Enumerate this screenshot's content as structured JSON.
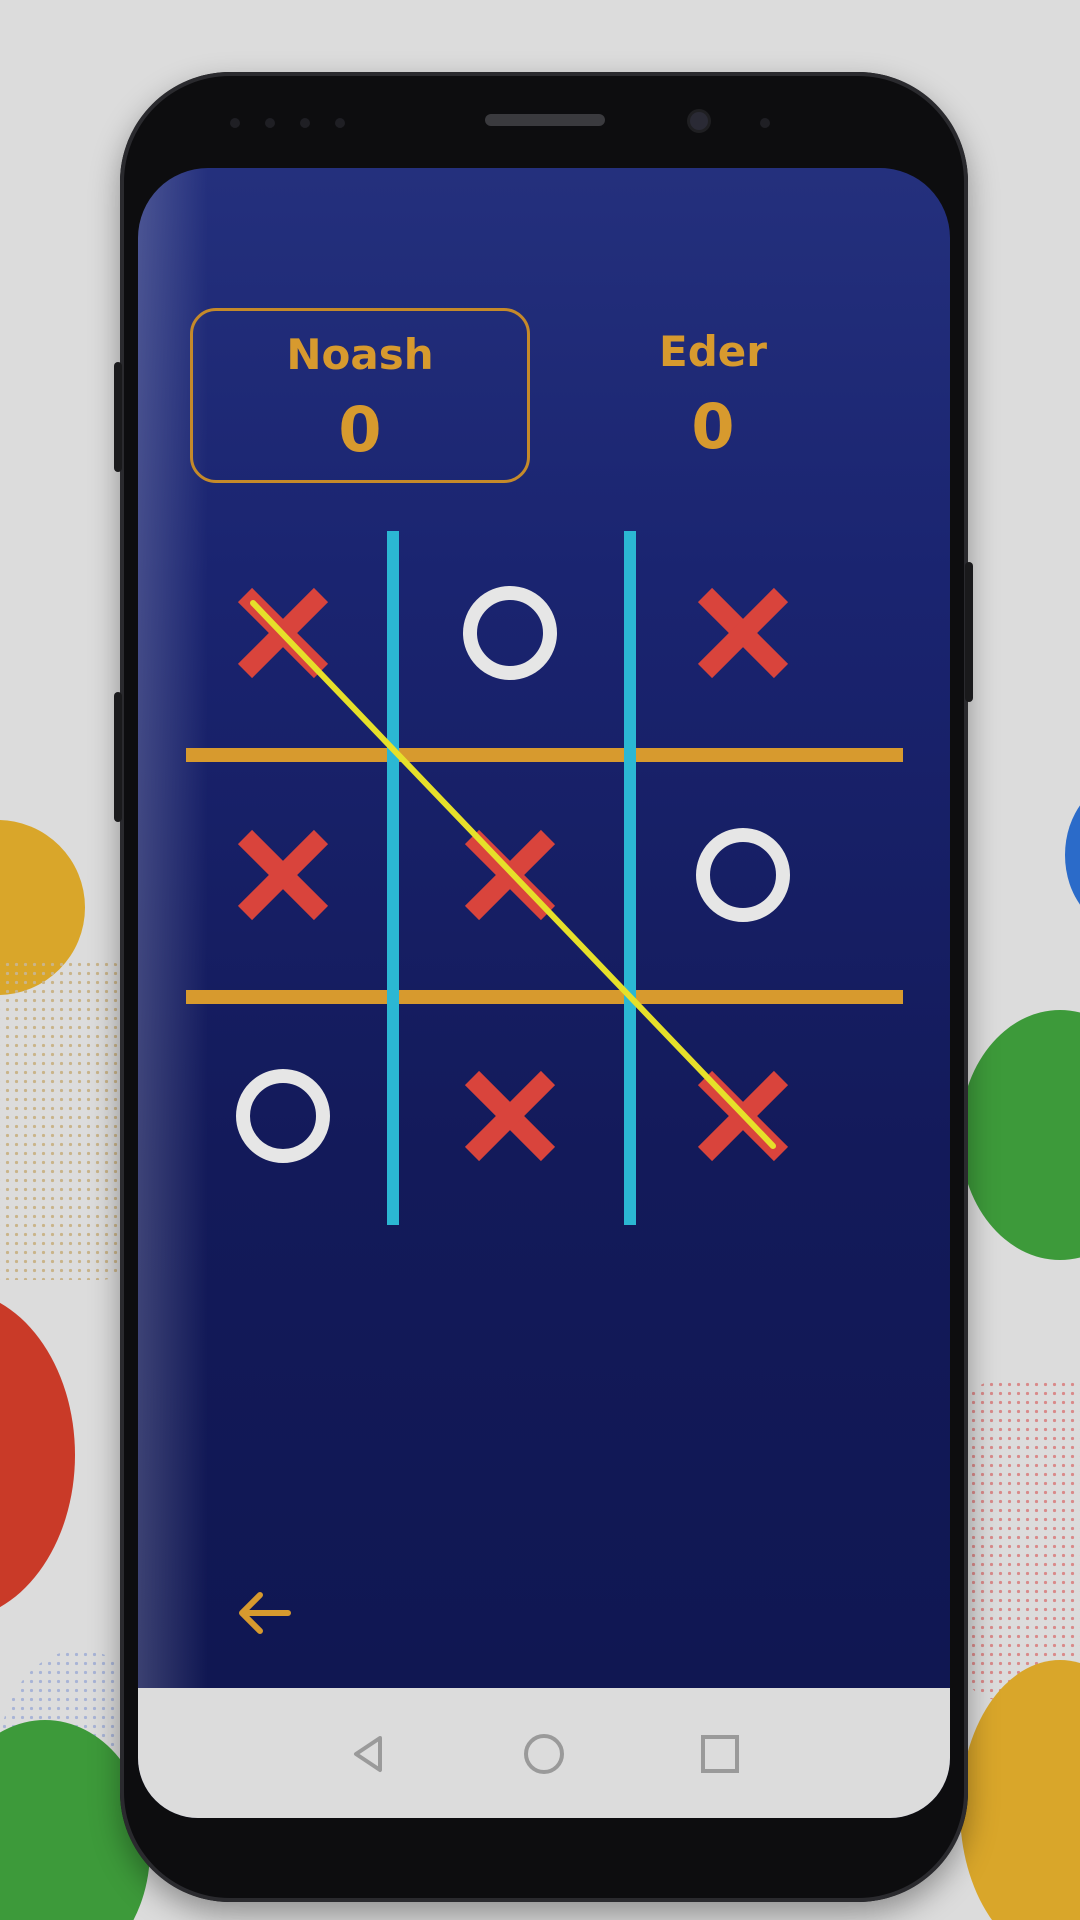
{
  "players": [
    {
      "name": "Noash",
      "score": "0",
      "active": true
    },
    {
      "name": "Eder",
      "score": "0",
      "active": false
    }
  ],
  "board": [
    [
      "X",
      "O",
      "X"
    ],
    [
      "X",
      "X",
      "O"
    ],
    [
      "O",
      "X",
      "X"
    ]
  ],
  "winning_line": "diagonal-top-left-to-bottom-right",
  "colors": {
    "screen_bg": "#1a2470",
    "score_text": "#d79a2e",
    "x_mark": "#d9443c",
    "o_mark": "#e6e6e6",
    "vertical_grid": "#2bb7d3",
    "horizontal_grid": "#d79a2e",
    "win_line": "#e6e02a",
    "back_arrow": "#d79a2e"
  },
  "icons": {
    "back": "arrow-left-icon",
    "nav_back": "triangle-back-icon",
    "nav_home": "circle-home-icon",
    "nav_recents": "square-recents-icon"
  }
}
